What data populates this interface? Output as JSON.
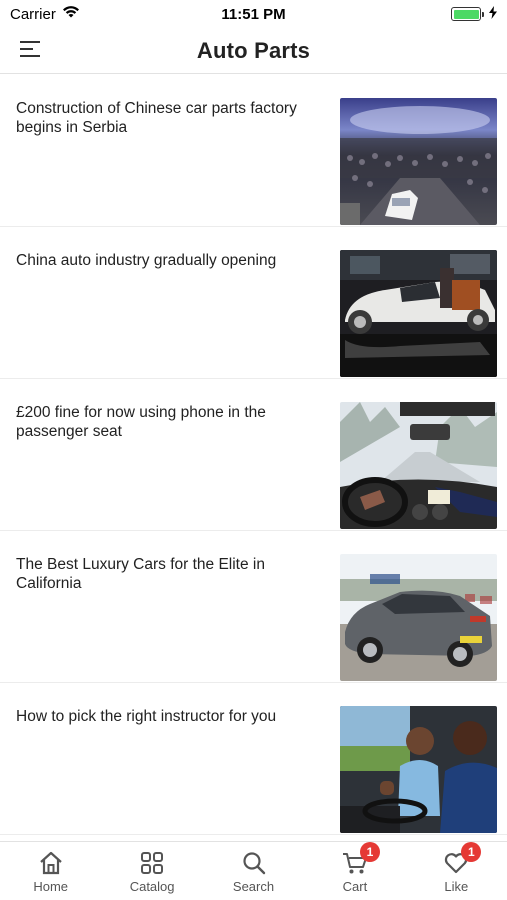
{
  "status_bar": {
    "carrier": "Carrier",
    "time": "11:51 PM",
    "battery_level": 1.0,
    "battery_color": "#4cd964"
  },
  "header": {
    "title": "Auto Parts",
    "menu_icon": "hamburger-menu-icon"
  },
  "news": [
    {
      "title": "Construction of Chinese car parts factory begins in Serbia",
      "image": "car-show-hall-photo"
    },
    {
      "title": "China auto industry gradually opening",
      "image": "luxury-car-showroom-photo"
    },
    {
      "title": "£200 fine for now using phone in the passenger seat",
      "image": "snowy-road-dashboard-photo"
    },
    {
      "title": "The Best Luxury Cars for the Elite in California",
      "image": "grey-sedan-photo"
    },
    {
      "title": "How to pick the right instructor for you",
      "image": "driving-lesson-photo"
    }
  ],
  "tabs": [
    {
      "label": "Home",
      "icon": "home-icon"
    },
    {
      "label": "Catalog",
      "icon": "grid-icon"
    },
    {
      "label": "Search",
      "icon": "search-icon"
    },
    {
      "label": "Cart",
      "icon": "cart-icon",
      "badge": "1"
    },
    {
      "label": "Like",
      "icon": "heart-icon",
      "badge": "1"
    }
  ],
  "colors": {
    "badge": "#e53935",
    "divider": "#ececec"
  }
}
